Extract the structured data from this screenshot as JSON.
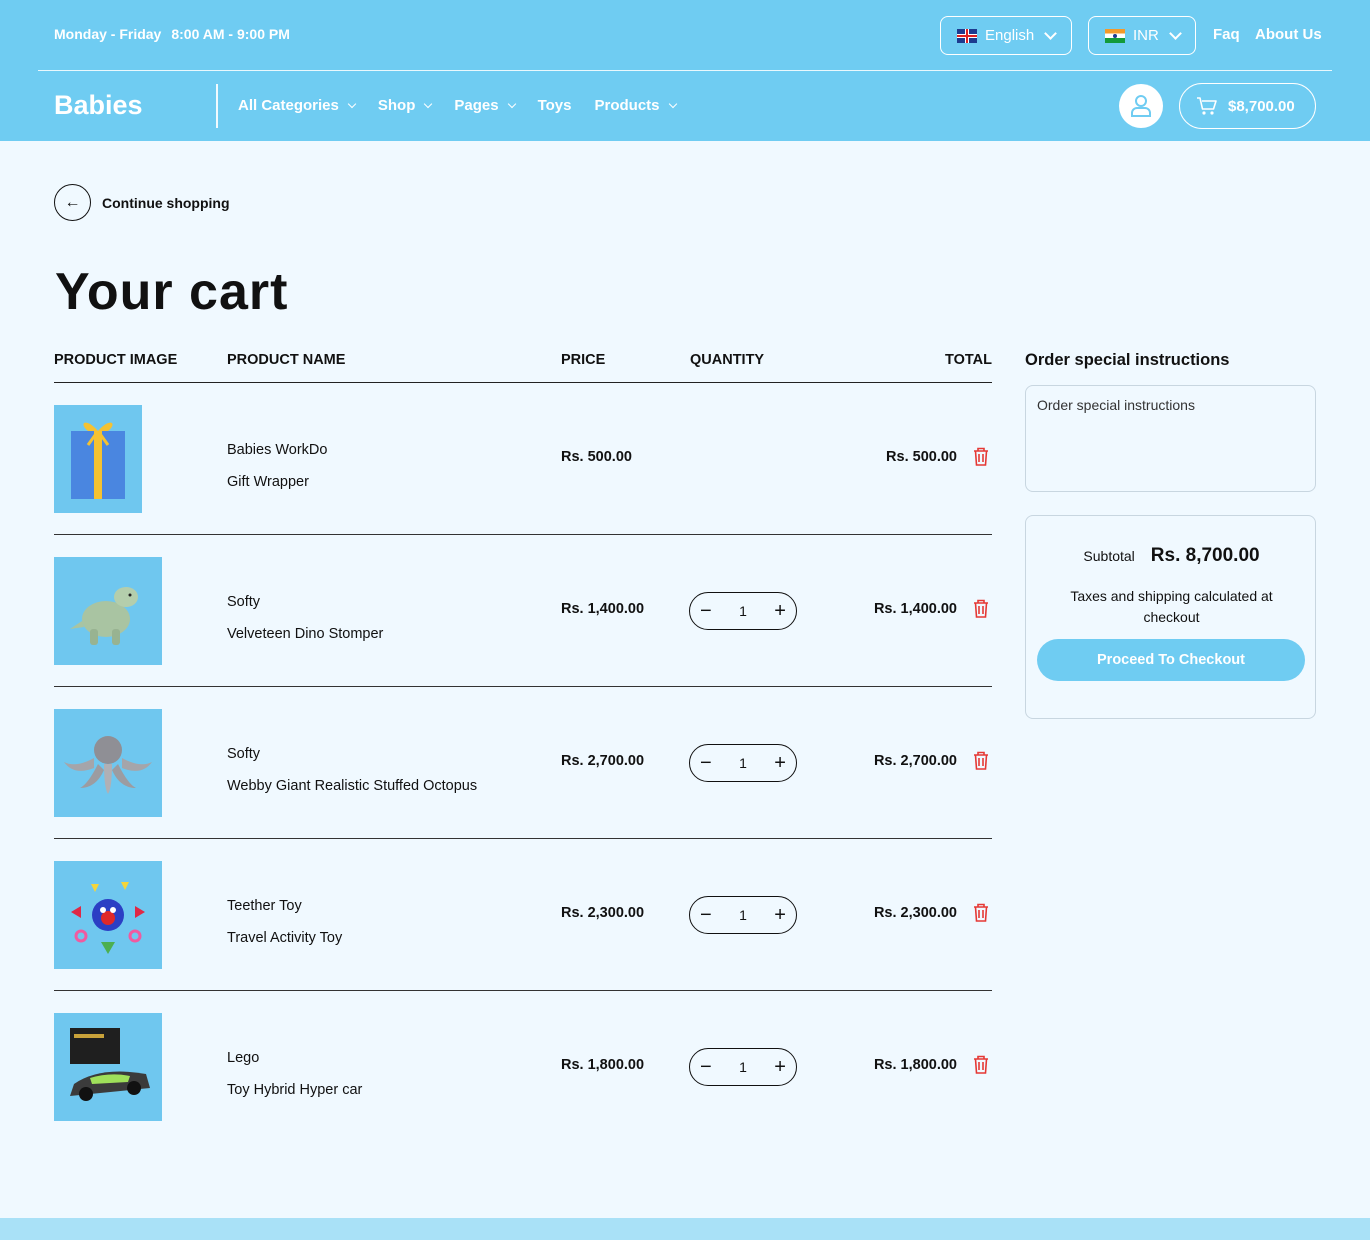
{
  "topbar": {
    "days": "Monday - Friday",
    "time": "8:00 AM - 9:00 PM",
    "language": "English",
    "currency": "INR",
    "faq": "Faq",
    "about": "About Us"
  },
  "navbar": {
    "logo": "Babies",
    "items": [
      {
        "label": "All Categories",
        "dropdown": true
      },
      {
        "label": "Shop",
        "dropdown": true
      },
      {
        "label": "Pages",
        "dropdown": true
      },
      {
        "label": "Toys",
        "dropdown": false
      },
      {
        "label": "Products",
        "dropdown": true
      }
    ],
    "cart_total": "$8,700.00"
  },
  "main": {
    "back_label": "Continue shopping",
    "title": "Your cart",
    "columns": {
      "image": "PRODUCT IMAGE",
      "name": "PRODUCT NAME",
      "price": "PRICE",
      "quantity": "QUANTITY",
      "total": "TOTAL"
    },
    "items": [
      {
        "brand": "Babies WorkDo",
        "name": "Gift Wrapper",
        "price": "Rs. 500.00",
        "qty": "",
        "total": "Rs. 500.00",
        "image": "gift-box"
      },
      {
        "brand": "Softy",
        "name": "Velveteen Dino Stomper",
        "price": "Rs. 1,400.00",
        "qty": "1",
        "total": "Rs. 1,400.00",
        "image": "dino-plush"
      },
      {
        "brand": "Softy",
        "name": "Webby Giant Realistic Stuffed Octopus",
        "price": "Rs. 2,700.00",
        "qty": "1",
        "total": "Rs. 2,700.00",
        "image": "octopus-plush"
      },
      {
        "brand": "Teether Toy",
        "name": "Travel Activity Toy",
        "price": "Rs. 2,300.00",
        "qty": "1",
        "total": "Rs. 2,300.00",
        "image": "activity-toy"
      },
      {
        "brand": "Lego",
        "name": "Toy Hybrid Hyper car",
        "price": "Rs. 1,800.00",
        "qty": "1",
        "total": "Rs. 1,800.00",
        "image": "lego-car"
      }
    ]
  },
  "sidebar": {
    "heading": "Order special instructions",
    "placeholder": "Order special instructions",
    "subtotal_label": "Subtotal",
    "subtotal_value": "Rs. 8,700.00",
    "tax_note": "Taxes and shipping calculated at checkout",
    "checkout_label": "Proceed To Checkout"
  },
  "colors": {
    "header": "#6fccf2",
    "page_bg": "#f0f9ff",
    "trash": "#e53935"
  }
}
